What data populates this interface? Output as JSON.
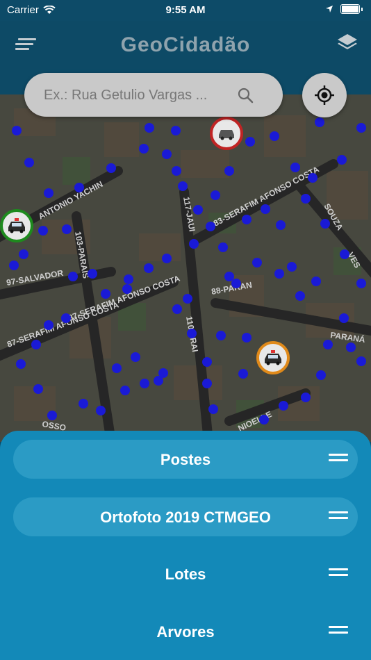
{
  "status_bar": {
    "carrier": "Carrier",
    "time": "9:55 AM"
  },
  "header": {
    "title": "GeoCidadão"
  },
  "search": {
    "placeholder": "Ex.: Rua Getulio Vargas ..."
  },
  "map": {
    "street_labels": [
      "ANTONIO YACHIN",
      "97-SALVADOR",
      "87-SERAFIM AFONSO COSTA",
      "87-SERAFIM AFONSO COSTA",
      "83-SERAFIM AFONSO COSTA",
      "117-JAUI",
      "103-PARAIS",
      "110-PRAI",
      "88-PARAN",
      "PARANÁ",
      "SOUZA",
      "VES",
      "NIOELLE",
      "OSSO"
    ],
    "marker_colors": {
      "red": "#c02424",
      "green": "#1e8a1e",
      "orange": "#e08a1a"
    },
    "point_color": "#1a1ad6"
  },
  "layers": [
    {
      "label": "Postes"
    },
    {
      "label": "Ortofoto 2019 CTMGEO"
    },
    {
      "label": "Lotes"
    },
    {
      "label": "Arvores"
    }
  ],
  "colors": {
    "header_bg": "#0d4a66",
    "sheet_bg": "#1389b8",
    "selected_row": "#2b9bc5"
  }
}
